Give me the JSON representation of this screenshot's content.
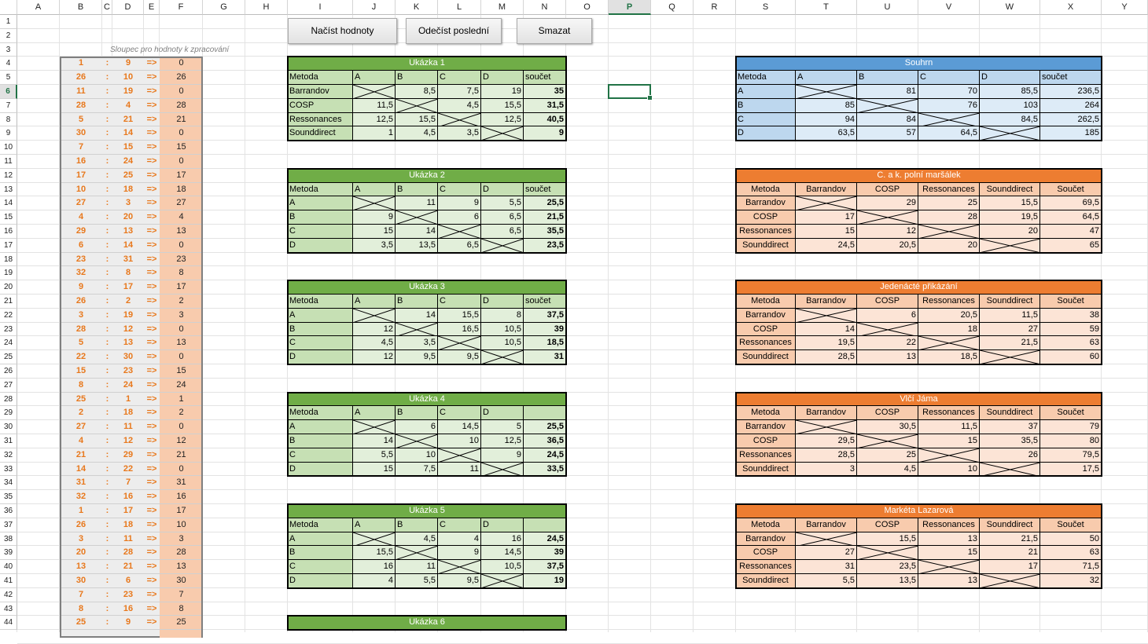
{
  "columns": [
    "A",
    "B",
    "C",
    "D",
    "E",
    "F",
    "G",
    "H",
    "I",
    "J",
    "K",
    "L",
    "M",
    "N",
    "O",
    "P",
    "Q",
    "R",
    "S",
    "T",
    "U",
    "V",
    "W",
    "X",
    "Y"
  ],
  "selected_column": "P",
  "selected_row": 6,
  "buttons": {
    "load": "Načíst hodnoty",
    "subtract": "Odečíst poslední",
    "delete": "Smazat"
  },
  "processing_label": "Sloupec pro hodnoty k zpracování",
  "arrow_text": "=>",
  "colon_text": ":",
  "list_rows": [
    [
      1,
      9,
      0
    ],
    [
      26,
      10,
      26
    ],
    [
      11,
      19,
      0
    ],
    [
      28,
      4,
      28
    ],
    [
      5,
      21,
      21
    ],
    [
      30,
      14,
      0
    ],
    [
      7,
      15,
      15
    ],
    [
      16,
      24,
      0
    ],
    [
      17,
      25,
      17
    ],
    [
      10,
      18,
      18
    ],
    [
      27,
      3,
      27
    ],
    [
      4,
      20,
      4
    ],
    [
      29,
      13,
      13
    ],
    [
      6,
      14,
      0
    ],
    [
      23,
      31,
      23
    ],
    [
      32,
      8,
      8
    ],
    [
      9,
      17,
      17
    ],
    [
      26,
      2,
      2
    ],
    [
      3,
      19,
      3
    ],
    [
      28,
      12,
      0
    ],
    [
      5,
      13,
      13
    ],
    [
      22,
      30,
      0
    ],
    [
      15,
      23,
      15
    ],
    [
      8,
      24,
      24
    ],
    [
      25,
      1,
      1
    ],
    [
      2,
      18,
      2
    ],
    [
      27,
      11,
      0
    ],
    [
      4,
      12,
      12
    ],
    [
      21,
      29,
      21
    ],
    [
      14,
      22,
      0
    ],
    [
      31,
      7,
      31
    ],
    [
      32,
      16,
      16
    ],
    [
      1,
      17,
      17
    ],
    [
      26,
      18,
      10
    ],
    [
      3,
      11,
      3
    ],
    [
      20,
      28,
      28
    ],
    [
      13,
      21,
      13
    ],
    [
      30,
      6,
      30
    ],
    [
      7,
      23,
      7
    ],
    [
      8,
      16,
      8
    ],
    [
      25,
      9,
      25
    ]
  ],
  "green_tables": [
    {
      "title": "Ukázka 1",
      "headers": [
        "Metoda",
        "A",
        "B",
        "C",
        "D",
        "součet"
      ],
      "rows": [
        [
          "Barrandov",
          "",
          "8,5",
          "7,5",
          "19",
          "35"
        ],
        [
          "COSP",
          "11,5",
          "",
          "4,5",
          "15,5",
          "31,5"
        ],
        [
          "Ressonances",
          "12,5",
          "15,5",
          "",
          "12,5",
          "40,5"
        ],
        [
          "Sounddirect",
          "1",
          "4,5",
          "3,5",
          "",
          "9"
        ]
      ]
    },
    {
      "title": "Ukázka 2",
      "headers": [
        "Metoda",
        "A",
        "B",
        "C",
        "D",
        "součet"
      ],
      "rows": [
        [
          "A",
          "",
          "11",
          "9",
          "5,5",
          "25,5"
        ],
        [
          "B",
          "9",
          "",
          "6",
          "6,5",
          "21,5"
        ],
        [
          "C",
          "15",
          "14",
          "",
          "6,5",
          "35,5"
        ],
        [
          "D",
          "3,5",
          "13,5",
          "6,5",
          "",
          "23,5"
        ]
      ]
    },
    {
      "title": "Ukázka 3",
      "headers": [
        "Metoda",
        "A",
        "B",
        "C",
        "D",
        "součet"
      ],
      "rows": [
        [
          "A",
          "",
          "14",
          "15,5",
          "8",
          "37,5"
        ],
        [
          "B",
          "12",
          "",
          "16,5",
          "10,5",
          "39"
        ],
        [
          "C",
          "4,5",
          "3,5",
          "",
          "10,5",
          "18,5"
        ],
        [
          "D",
          "12",
          "9,5",
          "9,5",
          "",
          "31"
        ]
      ]
    },
    {
      "title": "Ukázka 4",
      "headers": [
        "Metoda",
        "A",
        "B",
        "C",
        "D",
        ""
      ],
      "rows": [
        [
          "A",
          "",
          "6",
          "14,5",
          "5",
          "25,5"
        ],
        [
          "B",
          "14",
          "",
          "10",
          "12,5",
          "36,5"
        ],
        [
          "C",
          "5,5",
          "10",
          "",
          "9",
          "24,5"
        ],
        [
          "D",
          "15",
          "7,5",
          "11",
          "",
          "33,5"
        ]
      ]
    },
    {
      "title": "Ukázka 5",
      "headers": [
        "Metoda",
        "A",
        "B",
        "C",
        "D",
        ""
      ],
      "rows": [
        [
          "A",
          "",
          "4,5",
          "4",
          "16",
          "24,5"
        ],
        [
          "B",
          "15,5",
          "",
          "9",
          "14,5",
          "39"
        ],
        [
          "C",
          "16",
          "11",
          "",
          "10,5",
          "37,5"
        ],
        [
          "D",
          "4",
          "5,5",
          "9,5",
          "",
          "19"
        ]
      ]
    },
    {
      "title": "Ukázka 6",
      "headers": [],
      "rows": []
    }
  ],
  "summary_table": {
    "title": "Souhrn",
    "headers": [
      "Metoda",
      "A",
      "B",
      "C",
      "D",
      "součet"
    ],
    "rows": [
      [
        "A",
        "",
        "81",
        "70",
        "85,5",
        "236,5"
      ],
      [
        "B",
        "85",
        "",
        "76",
        "103",
        "264"
      ],
      [
        "C",
        "94",
        "84",
        "",
        "84,5",
        "262,5"
      ],
      [
        "D",
        "63,5",
        "57",
        "64,5",
        "",
        "185"
      ]
    ]
  },
  "orange_tables": [
    {
      "title": "C. a k. polní maršálek",
      "headers": [
        "Metoda",
        "Barrandov",
        "COSP",
        "Ressonances",
        "Sounddirect",
        "Součet"
      ],
      "rows": [
        [
          "Barrandov",
          "",
          "29",
          "25",
          "15,5",
          "69,5"
        ],
        [
          "COSP",
          "17",
          "",
          "28",
          "19,5",
          "64,5"
        ],
        [
          "Ressonances",
          "15",
          "12",
          "",
          "20",
          "47"
        ],
        [
          "Sounddirect",
          "24,5",
          "20,5",
          "20",
          "",
          "65"
        ]
      ]
    },
    {
      "title": "Jedenácté přikázání",
      "headers": [
        "Metoda",
        "Barrandov",
        "COSP",
        "Ressonances",
        "Sounddirect",
        "Součet"
      ],
      "rows": [
        [
          "Barrandov",
          "",
          "6",
          "20,5",
          "11,5",
          "38"
        ],
        [
          "COSP",
          "14",
          "",
          "18",
          "27",
          "59"
        ],
        [
          "Ressonances",
          "19,5",
          "22",
          "",
          "21,5",
          "63"
        ],
        [
          "Sounddirect",
          "28,5",
          "13",
          "18,5",
          "",
          "60"
        ]
      ]
    },
    {
      "title": "Vlčí Jáma",
      "headers": [
        "Metoda",
        "Barrandov",
        "COSP",
        "Ressonances",
        "Sounddirect",
        "Součet"
      ],
      "rows": [
        [
          "Barrandov",
          "",
          "30,5",
          "11,5",
          "37",
          "79"
        ],
        [
          "COSP",
          "29,5",
          "",
          "15",
          "35,5",
          "80"
        ],
        [
          "Ressonances",
          "28,5",
          "25",
          "",
          "26",
          "79,5"
        ],
        [
          "Sounddirect",
          "3",
          "4,5",
          "10",
          "",
          "17,5"
        ]
      ]
    },
    {
      "title": "Markéta Lazarová",
      "headers": [
        "Metoda",
        "Barrandov",
        "COSP",
        "Ressonances",
        "Sounddirect",
        "Součet"
      ],
      "rows": [
        [
          "Barrandov",
          "",
          "15,5",
          "13",
          "21,5",
          "50"
        ],
        [
          "COSP",
          "27",
          "",
          "15",
          "21",
          "63"
        ],
        [
          "Ressonances",
          "31",
          "23,5",
          "",
          "17",
          "71,5"
        ],
        [
          "Sounddirect",
          "5,5",
          "13,5",
          "13",
          "",
          "32"
        ]
      ]
    }
  ],
  "colors": {
    "green_title": "#70ad47",
    "green_header": "#c6e0b4",
    "green_light": "#e2efda",
    "blue_title": "#5b9bd5",
    "blue_header": "#bdd7ee",
    "blue_light": "#ddebf7",
    "orange_title": "#ed7d31",
    "orange_header": "#f8cbad",
    "orange_light": "#fce4d6",
    "list_grey": "#ededed",
    "list_orange": "#f8cbad",
    "accent": "#217346"
  }
}
